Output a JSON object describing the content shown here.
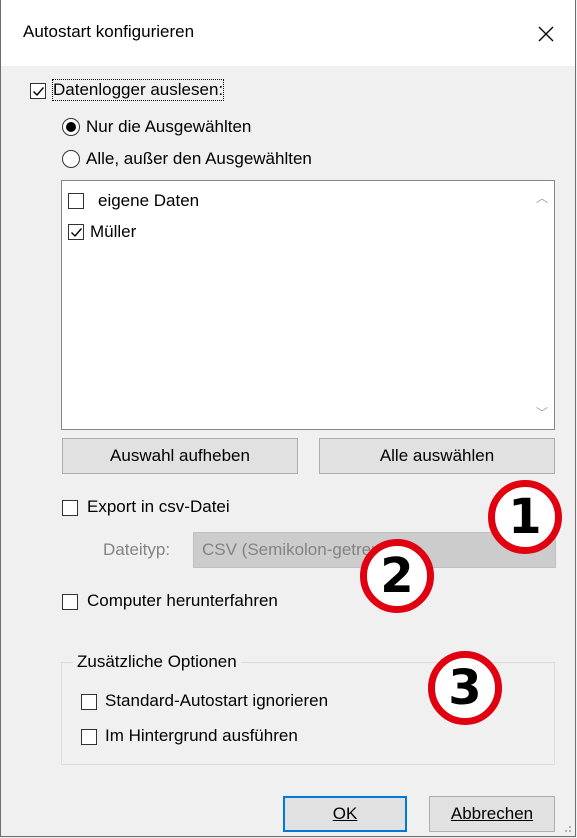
{
  "window": {
    "title": "Autostart konfigurieren"
  },
  "datenlogger": {
    "label": "Datenlogger auslesen:",
    "checked": true
  },
  "radios": [
    {
      "label": "Nur die Ausgewählten",
      "selected": true
    },
    {
      "label": "Alle, außer den Ausgewählten",
      "selected": false
    }
  ],
  "list": {
    "items": [
      {
        "label": "eigene Daten",
        "checked": false
      },
      {
        "label": "Müller",
        "checked": true
      }
    ]
  },
  "buttons": {
    "deselect": "Auswahl aufheben",
    "select_all": "Alle auswählen",
    "ok": "OK",
    "cancel": "Abbrechen"
  },
  "export": {
    "label": "Export in csv-Datei",
    "checked": false
  },
  "filetype": {
    "label": "Dateityp:",
    "value": "CSV (Semikolon-getrennt)",
    "enabled": false
  },
  "shutdown": {
    "label": "Computer herunterfahren",
    "checked": false
  },
  "extra_options": {
    "title": "Zusätzliche Optionen",
    "ignore_default": {
      "label": "Standard-Autostart ignorieren",
      "checked": false
    },
    "background": {
      "label": "Im Hintergrund ausführen",
      "checked": false
    }
  },
  "annotations": [
    "1",
    "2",
    "3"
  ],
  "colors": {
    "annotation_ring": "#e0000f",
    "default_button_border": "#0078d7"
  }
}
